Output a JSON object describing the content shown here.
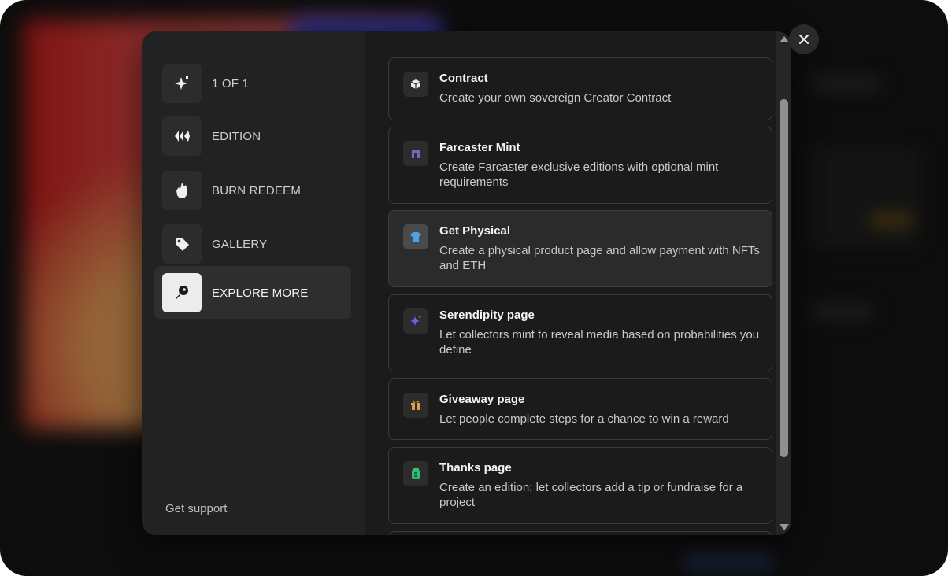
{
  "sidebar": {
    "items": [
      {
        "label": "1 OF 1",
        "icon": "sparkle-icon"
      },
      {
        "label": "EDITION",
        "icon": "edition-icon"
      },
      {
        "label": "BURN REDEEM",
        "icon": "flame-icon"
      },
      {
        "label": "GALLERY",
        "icon": "tag-icon"
      },
      {
        "label": "EXPLORE MORE",
        "icon": "explore-icon",
        "active": true
      }
    ],
    "support_label": "Get support"
  },
  "cards": [
    {
      "title": "Contract",
      "description": "Create your own sovereign Creator Contract",
      "icon": "cube-icon"
    },
    {
      "title": "Farcaster Mint",
      "description": "Create Farcaster exclusive editions with optional mint requirements",
      "icon": "farcaster-icon"
    },
    {
      "title": "Get Physical",
      "description": "Create a physical product page and allow payment with NFTs and ETH",
      "icon": "tshirt-icon",
      "highlighted": true
    },
    {
      "title": "Serendipity page",
      "description": "Let collectors mint to reveal media based on probabilities you define",
      "icon": "sparkle-icon"
    },
    {
      "title": "Giveaway page",
      "description": "Let people complete steps for a chance to win a reward",
      "icon": "gift-icon"
    },
    {
      "title": "Thanks page",
      "description": "Create an edition; let collectors add a tip or fundraise for a project",
      "icon": "money-jar-icon"
    }
  ],
  "colors": {
    "farcaster": "#7c65c1",
    "tshirt": "#4aa3e8",
    "serendipity": "#6b63f0",
    "gift": "#d9a441",
    "jar": "#2fbf71"
  },
  "close_icon": "close-icon"
}
